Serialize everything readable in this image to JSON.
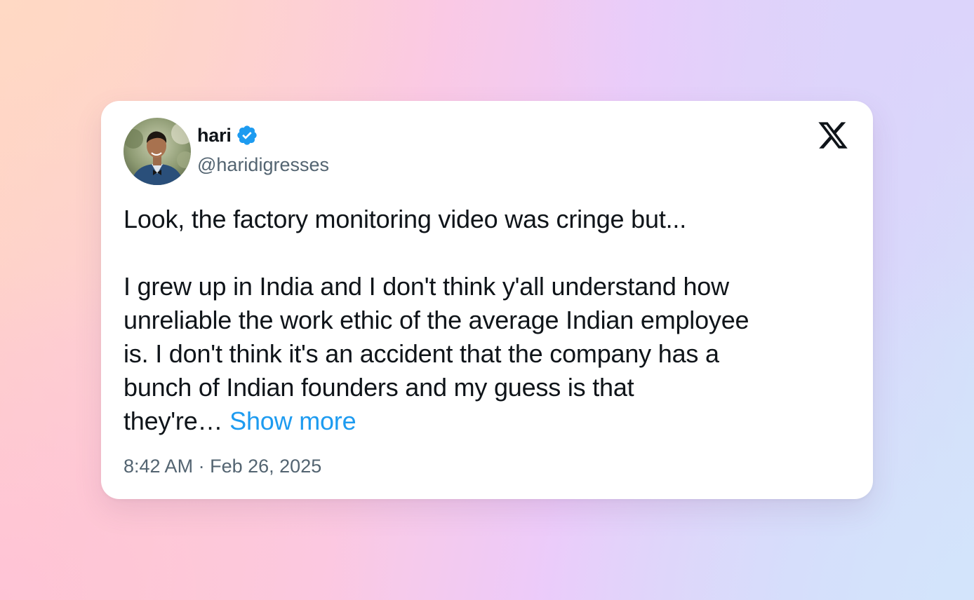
{
  "tweet": {
    "author": {
      "display_name": "hari",
      "handle": "@haridigresses",
      "verified": true
    },
    "text": {
      "line1": "Look, the factory monitoring video was cringe but...",
      "line2": "I grew up in India and I don't think y'all understand how",
      "line3": "unreliable the work ethic of the average Indian employee",
      "line4": "is. I don't think it's an accident that the company has a",
      "line5": "bunch of Indian founders and my guess is that",
      "line6": "they're…",
      "show_more": "Show more"
    },
    "time": "8:42 AM",
    "separator": "·",
    "date": "Feb 26, 2025"
  },
  "colors": {
    "link": "#1d9bf0",
    "verified_badge": "#1d9bf0",
    "secondary_text": "#536471",
    "primary_text": "#0f1419"
  },
  "icons": {
    "platform_logo": "x-logo-icon",
    "verified": "verified-badge-icon"
  }
}
